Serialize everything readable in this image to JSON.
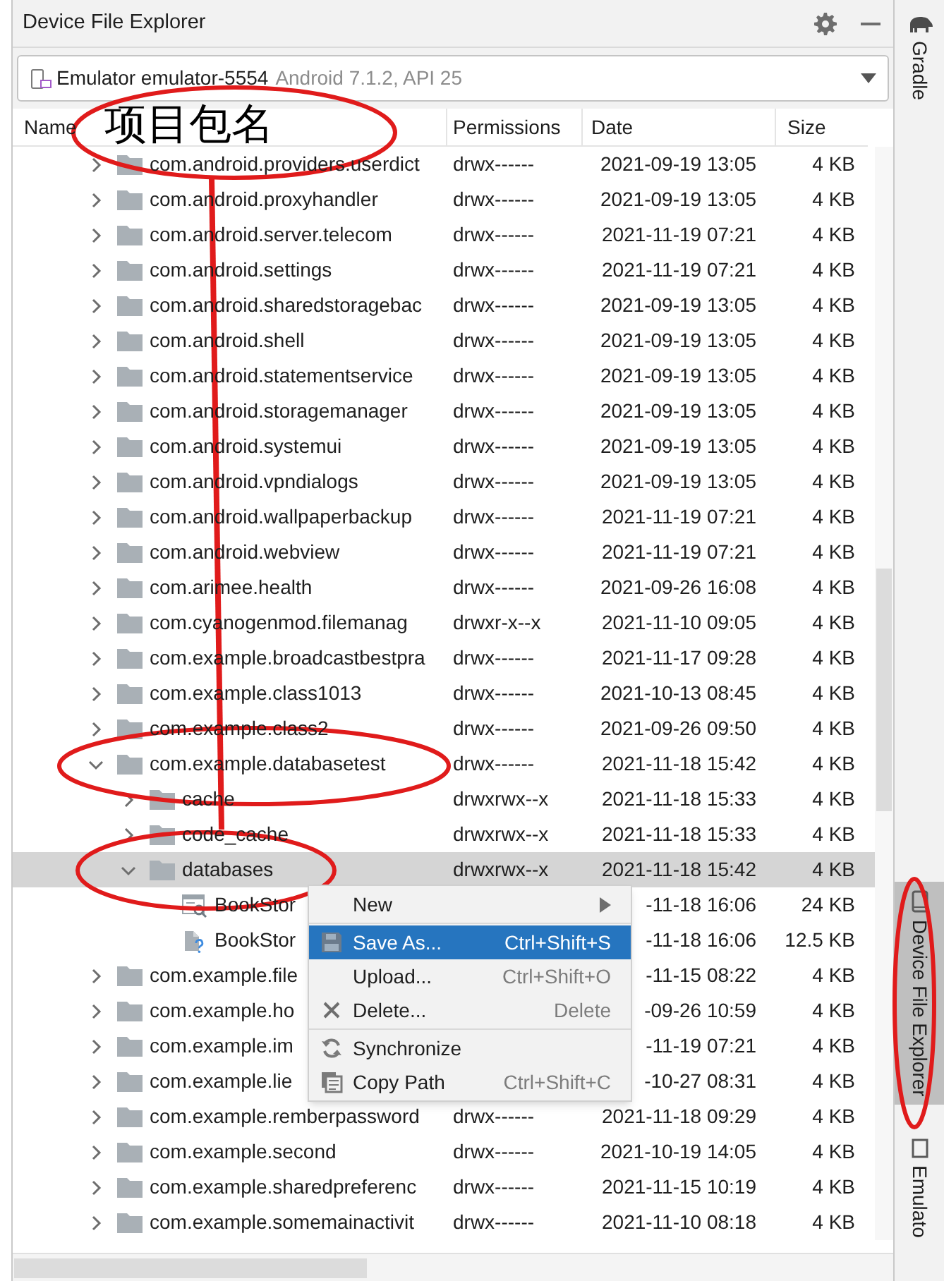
{
  "panel": {
    "title": "Device File Explorer"
  },
  "device_selector": {
    "device": "Emulator emulator-5554",
    "details": "Android 7.1.2, API 25"
  },
  "table": {
    "columns": [
      "Name",
      "Permissions",
      "Date",
      "Size"
    ],
    "rows": [
      {
        "kind": "folder",
        "name": "com.android.providers.userdict",
        "permissions": "drwx------",
        "date": "2021-09-19 13:05",
        "size": "4 KB",
        "expanded": false,
        "selected": false
      },
      {
        "kind": "folder",
        "name": "com.android.proxyhandler",
        "permissions": "drwx------",
        "date": "2021-09-19 13:05",
        "size": "4 KB",
        "expanded": false,
        "selected": false
      },
      {
        "kind": "folder",
        "name": "com.android.server.telecom",
        "permissions": "drwx------",
        "date": "2021-11-19 07:21",
        "size": "4 KB",
        "expanded": false,
        "selected": false
      },
      {
        "kind": "folder",
        "name": "com.android.settings",
        "permissions": "drwx------",
        "date": "2021-11-19 07:21",
        "size": "4 KB",
        "expanded": false,
        "selected": false
      },
      {
        "kind": "folder",
        "name": "com.android.sharedstoragebac",
        "permissions": "drwx------",
        "date": "2021-09-19 13:05",
        "size": "4 KB",
        "expanded": false,
        "selected": false
      },
      {
        "kind": "folder",
        "name": "com.android.shell",
        "permissions": "drwx------",
        "date": "2021-09-19 13:05",
        "size": "4 KB",
        "expanded": false,
        "selected": false
      },
      {
        "kind": "folder",
        "name": "com.android.statementservice",
        "permissions": "drwx------",
        "date": "2021-09-19 13:05",
        "size": "4 KB",
        "expanded": false,
        "selected": false
      },
      {
        "kind": "folder",
        "name": "com.android.storagemanager",
        "permissions": "drwx------",
        "date": "2021-09-19 13:05",
        "size": "4 KB",
        "expanded": false,
        "selected": false
      },
      {
        "kind": "folder",
        "name": "com.android.systemui",
        "permissions": "drwx------",
        "date": "2021-09-19 13:05",
        "size": "4 KB",
        "expanded": false,
        "selected": false
      },
      {
        "kind": "folder",
        "name": "com.android.vpndialogs",
        "permissions": "drwx------",
        "date": "2021-09-19 13:05",
        "size": "4 KB",
        "expanded": false,
        "selected": false
      },
      {
        "kind": "folder",
        "name": "com.android.wallpaperbackup",
        "permissions": "drwx------",
        "date": "2021-11-19 07:21",
        "size": "4 KB",
        "expanded": false,
        "selected": false
      },
      {
        "kind": "folder",
        "name": "com.android.webview",
        "permissions": "drwx------",
        "date": "2021-11-19 07:21",
        "size": "4 KB",
        "expanded": false,
        "selected": false
      },
      {
        "kind": "folder",
        "name": "com.arimee.health",
        "permissions": "drwx------",
        "date": "2021-09-26 16:08",
        "size": "4 KB",
        "expanded": false,
        "selected": false
      },
      {
        "kind": "folder",
        "name": "com.cyanogenmod.filemanag",
        "permissions": "drwxr-x--x",
        "date": "2021-11-10 09:05",
        "size": "4 KB",
        "expanded": false,
        "selected": false
      },
      {
        "kind": "folder",
        "name": "com.example.broadcastbestpra",
        "permissions": "drwx------",
        "date": "2021-11-17 09:28",
        "size": "4 KB",
        "expanded": false,
        "selected": false
      },
      {
        "kind": "folder",
        "name": "com.example.class1013",
        "permissions": "drwx------",
        "date": "2021-10-13 08:45",
        "size": "4 KB",
        "expanded": false,
        "selected": false
      },
      {
        "kind": "folder",
        "name": "com.example.class2",
        "permissions": "drwx------",
        "date": "2021-09-26 09:50",
        "size": "4 KB",
        "expanded": false,
        "selected": false
      },
      {
        "kind": "folder",
        "name": "com.example.databasetest",
        "permissions": "drwx------",
        "date": "2021-11-18 15:42",
        "size": "4 KB",
        "expanded": true,
        "selected": false,
        "children": [
          {
            "kind": "folder",
            "name": "cache",
            "permissions": "drwxrwx--x",
            "date": "2021-11-18 15:33",
            "size": "4 KB",
            "expanded": false,
            "selected": false
          },
          {
            "kind": "folder",
            "name": "code_cache",
            "permissions": "drwxrwx--x",
            "date": "2021-11-18 15:33",
            "size": "4 KB",
            "expanded": false,
            "selected": false
          },
          {
            "kind": "folder",
            "name": "databases",
            "permissions": "drwxrwx--x",
            "date": "2021-11-18 15:42",
            "size": "4 KB",
            "expanded": true,
            "selected": true,
            "children": [
              {
                "kind": "database",
                "name": "BookStor",
                "date": "-11-18 16:06",
                "size": "24 KB",
                "selected": false
              },
              {
                "kind": "unknown",
                "name": "BookStor",
                "date": "-11-18 16:06",
                "size": "12.5 KB",
                "selected": false
              }
            ]
          }
        ]
      },
      {
        "kind": "folder",
        "name": "com.example.file",
        "date": "-11-15 08:22",
        "size": "4 KB",
        "expanded": false,
        "selected": false
      },
      {
        "kind": "folder",
        "name": "com.example.ho",
        "date": "-09-26 10:59",
        "size": "4 KB",
        "expanded": false,
        "selected": false
      },
      {
        "kind": "folder",
        "name": "com.example.im",
        "date": "-11-19 07:21",
        "size": "4 KB",
        "expanded": false,
        "selected": false
      },
      {
        "kind": "folder",
        "name": "com.example.lie",
        "date": "-10-27 08:31",
        "size": "4 KB",
        "expanded": false,
        "selected": false
      },
      {
        "kind": "folder",
        "name": "com.example.remberpassword",
        "permissions": "drwx------",
        "date": "2021-11-18 09:29",
        "size": "4 KB",
        "expanded": false,
        "selected": false
      },
      {
        "kind": "folder",
        "name": "com.example.second",
        "permissions": "drwx------",
        "date": "2021-10-19 14:05",
        "size": "4 KB",
        "expanded": false,
        "selected": false
      },
      {
        "kind": "folder",
        "name": "com.example.sharedpreferenc",
        "permissions": "drwx------",
        "date": "2021-11-15 10:19",
        "size": "4 KB",
        "expanded": false,
        "selected": false
      },
      {
        "kind": "folder",
        "name": "com.example.somemainactivit",
        "permissions": "drwx------",
        "date": "2021-11-10 08:18",
        "size": "4 KB",
        "expanded": false,
        "selected": false
      }
    ]
  },
  "context_menu": {
    "groups": [
      [
        {
          "label": "New",
          "submenu": true,
          "selected": false
        }
      ],
      [
        {
          "label": "Save As...",
          "shortcut": "Ctrl+Shift+S",
          "submenu": false,
          "selected": true
        },
        {
          "label": "Upload...",
          "shortcut": "Ctrl+Shift+O",
          "submenu": false,
          "selected": false
        },
        {
          "label": "Delete...",
          "shortcut": "Delete",
          "submenu": false,
          "selected": false
        }
      ],
      [
        {
          "label": "Synchronize",
          "submenu": false,
          "selected": false
        },
        {
          "label": "Copy Path",
          "shortcut": "Ctrl+Shift+C",
          "submenu": false,
          "selected": false
        }
      ]
    ]
  },
  "tool_window_bar": {
    "items": [
      {
        "label": "Gradle",
        "selected": false
      },
      {
        "label": "Device File Explorer",
        "selected": true
      },
      {
        "label": "Emulato",
        "selected": false
      }
    ]
  },
  "annotation": {
    "label": "项目包名"
  }
}
